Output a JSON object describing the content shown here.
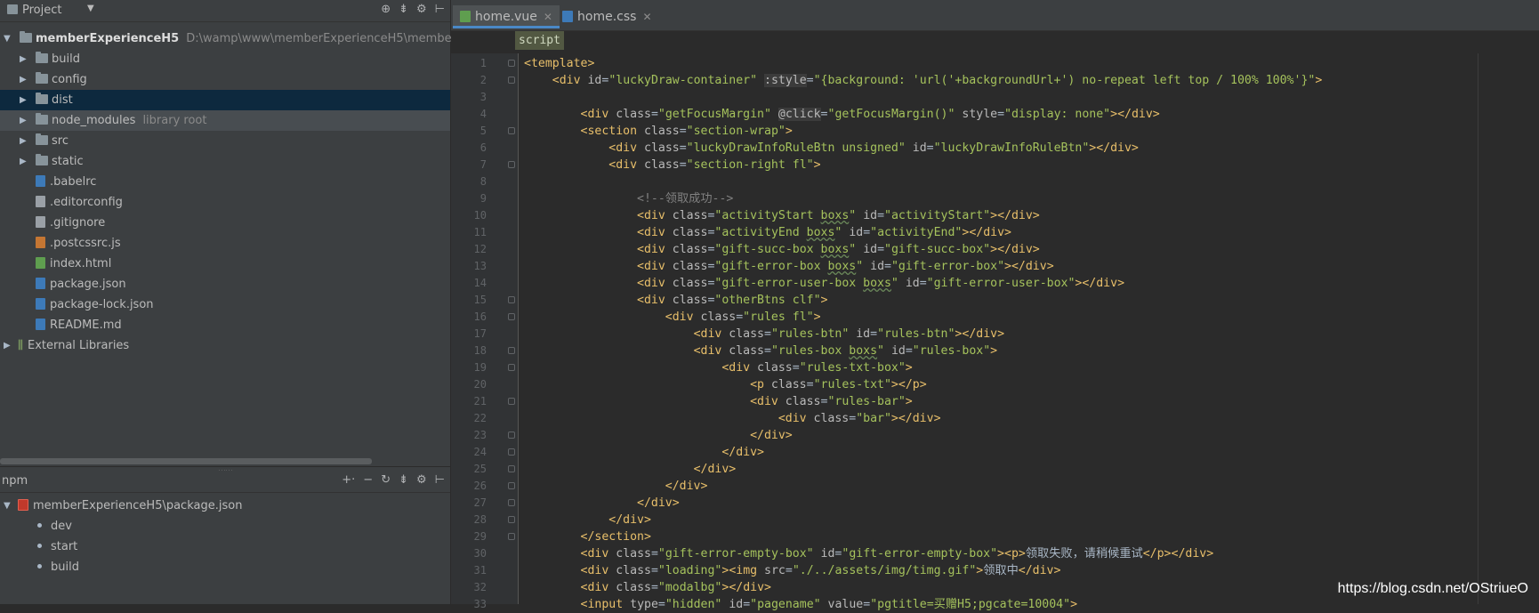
{
  "project_panel": {
    "title": "Project",
    "tree": [
      {
        "label": "memberExperienceH5",
        "hint": "D:\\wamp\\www\\memberExperienceH5\\membe",
        "type": "root"
      },
      {
        "label": "build",
        "type": "folder"
      },
      {
        "label": "config",
        "type": "folder"
      },
      {
        "label": "dist",
        "type": "folder",
        "selected": true
      },
      {
        "label": "node_modules",
        "hint": "library root",
        "type": "folder"
      },
      {
        "label": "src",
        "type": "folder"
      },
      {
        "label": "static",
        "type": "folder"
      },
      {
        "label": ".babelrc",
        "type": "file",
        "color": "#3d7ab8"
      },
      {
        "label": ".editorconfig",
        "type": "file",
        "color": "#9aa0a6"
      },
      {
        "label": ".gitignore",
        "type": "file",
        "color": "#9aa0a6"
      },
      {
        "label": ".postcssrc.js",
        "type": "file",
        "color": "#c57633"
      },
      {
        "label": "index.html",
        "type": "file",
        "color": "#5f9e4f"
      },
      {
        "label": "package.json",
        "type": "file",
        "color": "#3d7ab8"
      },
      {
        "label": "package-lock.json",
        "type": "file",
        "color": "#3d7ab8"
      },
      {
        "label": "README.md",
        "type": "file",
        "color": "#3d7ab8"
      },
      {
        "label": "External Libraries",
        "type": "libs"
      }
    ]
  },
  "npm_panel": {
    "title": "npm",
    "package": "memberExperienceH5\\package.json",
    "scripts": [
      "dev",
      "start",
      "build"
    ]
  },
  "editor": {
    "tabs": [
      {
        "label": "home.vue",
        "active": true,
        "icon_color": "#5f9e4f"
      },
      {
        "label": "home.css",
        "active": false,
        "icon_color": "#3d7ab8"
      }
    ],
    "breadcrumb": "script",
    "code": [
      {
        "ln": "1",
        "text": "<template>"
      },
      {
        "ln": "2",
        "text": "    <div id=\"luckyDraw-container\" :style=\"{background: 'url('+backgroundUrl+') no-repeat left top / 100% 100%'}\">"
      },
      {
        "ln": "3",
        "text": ""
      },
      {
        "ln": "4",
        "text": "        <div class=\"getFocusMargin\" @click=\"getFocusMargin()\" style=\"display: none\"></div>"
      },
      {
        "ln": "5",
        "text": "        <section class=\"section-wrap\">"
      },
      {
        "ln": "6",
        "text": "            <div class=\"luckyDrawInfoRuleBtn unsigned\" id=\"luckyDrawInfoRuleBtn\"></div>"
      },
      {
        "ln": "7",
        "text": "            <div class=\"section-right fl\">"
      },
      {
        "ln": "8",
        "text": ""
      },
      {
        "ln": "9",
        "text": "                <!--领取成功-->"
      },
      {
        "ln": "10",
        "text": "                <div class=\"activityStart boxs\" id=\"activityStart\"></div>"
      },
      {
        "ln": "11",
        "text": "                <div class=\"activityEnd boxs\" id=\"activityEnd\"></div>"
      },
      {
        "ln": "12",
        "text": "                <div class=\"gift-succ-box boxs\" id=\"gift-succ-box\"></div>"
      },
      {
        "ln": "13",
        "text": "                <div class=\"gift-error-box boxs\" id=\"gift-error-box\"></div>"
      },
      {
        "ln": "14",
        "text": "                <div class=\"gift-error-user-box boxs\" id=\"gift-error-user-box\"></div>"
      },
      {
        "ln": "15",
        "text": "                <div class=\"otherBtns clf\">"
      },
      {
        "ln": "16",
        "text": "                    <div class=\"rules fl\">"
      },
      {
        "ln": "17",
        "text": "                        <div class=\"rules-btn\" id=\"rules-btn\"></div>"
      },
      {
        "ln": "18",
        "text": "                        <div class=\"rules-box boxs\" id=\"rules-box\">"
      },
      {
        "ln": "19",
        "text": "                            <div class=\"rules-txt-box\">"
      },
      {
        "ln": "20",
        "text": "                                <p class=\"rules-txt\"></p>"
      },
      {
        "ln": "21",
        "text": "                                <div class=\"rules-bar\">"
      },
      {
        "ln": "22",
        "text": "                                    <div class=\"bar\"></div>"
      },
      {
        "ln": "23",
        "text": "                                </div>"
      },
      {
        "ln": "24",
        "text": "                            </div>"
      },
      {
        "ln": "25",
        "text": "                        </div>"
      },
      {
        "ln": "26",
        "text": "                    </div>"
      },
      {
        "ln": "27",
        "text": "                </div>"
      },
      {
        "ln": "28",
        "text": "            </div>"
      },
      {
        "ln": "29",
        "text": "        </section>"
      },
      {
        "ln": "30",
        "text": "        <div class=\"gift-error-empty-box\" id=\"gift-error-empty-box\"><p>领取失败，请稍候重试</p></div>"
      },
      {
        "ln": "31",
        "text": "        <div class=\"loading\"><img src=\"./../assets/img/timg.gif\">领取中</div>"
      },
      {
        "ln": "32",
        "text": "        <div class=\"modalbg\"></div>"
      },
      {
        "ln": "33",
        "text": "        <input type=\"hidden\" id=\"pagename\" value=\"pgtitle=买赠H5;pgcate=10004\">"
      }
    ]
  },
  "watermark": "https://blog.csdn.net/OStriueO"
}
